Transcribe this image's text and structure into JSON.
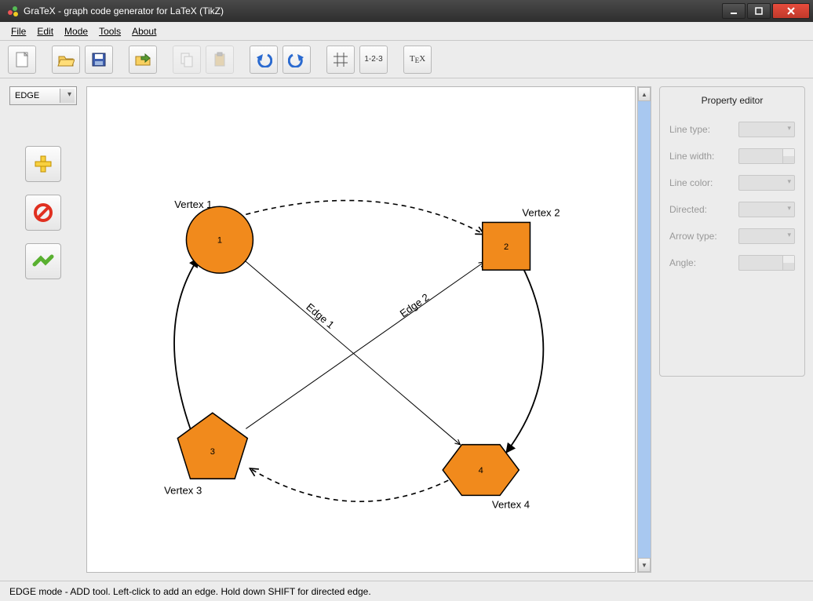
{
  "window": {
    "title": "GraTeX - graph code generator for LaTeX (TikZ)"
  },
  "menu": {
    "file": "File",
    "edit": "Edit",
    "mode": "Mode",
    "tools": "Tools",
    "about": "About"
  },
  "toolbar": {
    "new": "New",
    "open": "Open",
    "save": "Save",
    "export": "Export",
    "copy": "Copy",
    "paste": "Paste",
    "undo": "Undo",
    "redo": "Redo",
    "grid": "Grid",
    "numbering": "1-2-3",
    "tex": "TEX"
  },
  "left": {
    "mode": "EDGE",
    "add": "Add",
    "remove": "Remove",
    "select": "Select"
  },
  "canvas": {
    "vertices": [
      {
        "id": "1",
        "label": "Vertex 1"
      },
      {
        "id": "2",
        "label": "Vertex 2"
      },
      {
        "id": "3",
        "label": "Vertex 3"
      },
      {
        "id": "4",
        "label": "Vertex 4"
      }
    ],
    "edges": [
      {
        "label": "Edge 1"
      },
      {
        "label": "Edge 2"
      }
    ]
  },
  "propEditor": {
    "title": "Property editor",
    "rows": {
      "lineType": "Line type:",
      "lineWidth": "Line width:",
      "lineColor": "Line color:",
      "directed": "Directed:",
      "arrowType": "Arrow type:",
      "angle": "Angle:"
    }
  },
  "status": "EDGE mode - ADD tool. Left-click to add an edge. Hold down SHIFT for directed edge."
}
